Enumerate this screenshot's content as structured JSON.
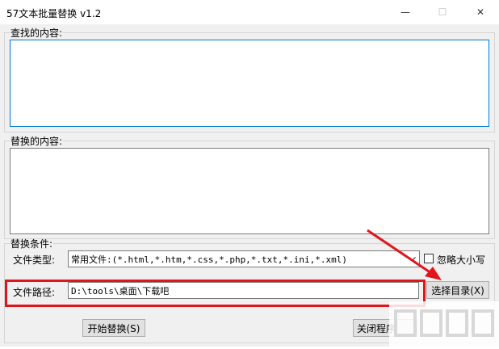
{
  "window": {
    "title": "57文本批量替换 v1.2",
    "controls": {
      "minimize_icon": "—",
      "maximize_icon": "☐",
      "close_icon": "✕"
    }
  },
  "find": {
    "label": "查找的内容:",
    "value": ""
  },
  "replace": {
    "label": "替换的内容:",
    "value": ""
  },
  "conditions": {
    "label": "替换条件:",
    "file_type_label": "文件类型:",
    "file_type_value": "常用文件:(*.html,*.htm,*.css,*.php,*.txt,*.ini,*.xml)",
    "ignore_case_label": "忽略大小写",
    "ignore_case_checked": false,
    "path_label": "文件路径:",
    "path_value": "D:\\tools\\桌面\\下载吧",
    "choose_dir_label": "选择目录(X)"
  },
  "buttons": {
    "start": "开始替换(S)",
    "close": "关闭程序"
  },
  "colors": {
    "highlight": "#e1161c",
    "focus_border": "#0078d7",
    "window_bg": "#f0f0f0"
  }
}
